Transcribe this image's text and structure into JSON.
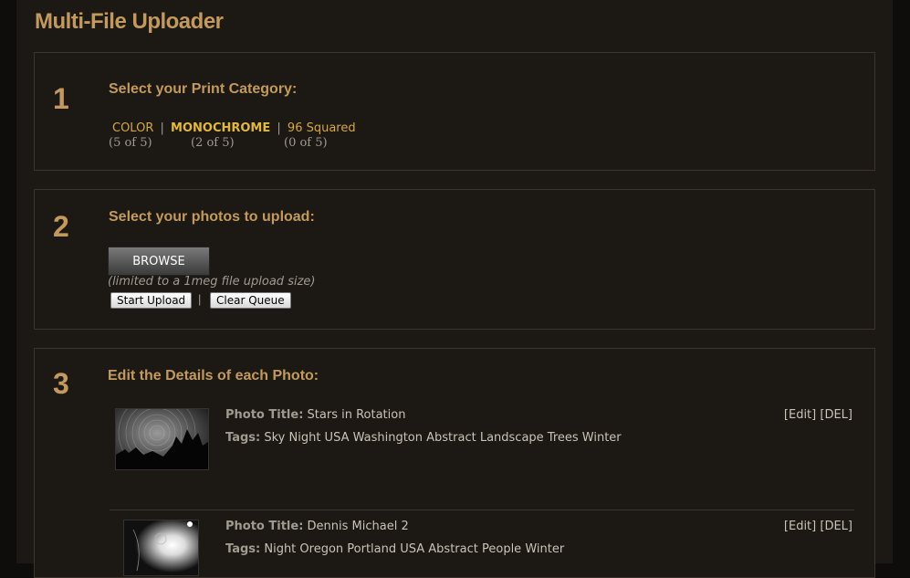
{
  "page_title": "Multi-File Uploader",
  "step1": {
    "number": "1",
    "heading": "Select your Print Category:",
    "categories": [
      {
        "label": "COLOR",
        "count": "(5 of 5)"
      },
      {
        "label": "MONOCHROME",
        "count": "(2 of 5)"
      },
      {
        "label": "96 Squared",
        "count": "(0 of 5)"
      }
    ],
    "separator": "|"
  },
  "step2": {
    "number": "2",
    "heading": "Select your photos to upload:",
    "browse_label": "BROWSE",
    "limit_note": "(limited to a 1meg file upload size)",
    "start_label": "Start Upload",
    "separator": "|",
    "clear_label": "Clear Queue"
  },
  "step3": {
    "number": "3",
    "heading": "Edit the Details of each Photo:",
    "title_label": "Photo Title:",
    "tags_label": "Tags:",
    "edit_label": "[Edit]",
    "del_label": "[DEL]",
    "photos": [
      {
        "title": "Stars in Rotation",
        "tags": "Sky Night USA Washington Abstract Landscape Trees Winter"
      },
      {
        "title": "Dennis Michael 2",
        "tags": "Night Oregon Portland USA Abstract People Winter"
      }
    ]
  },
  "colors": {
    "accent": "#c39a5c",
    "link": "#d4a73f",
    "background": "#1c1915"
  }
}
